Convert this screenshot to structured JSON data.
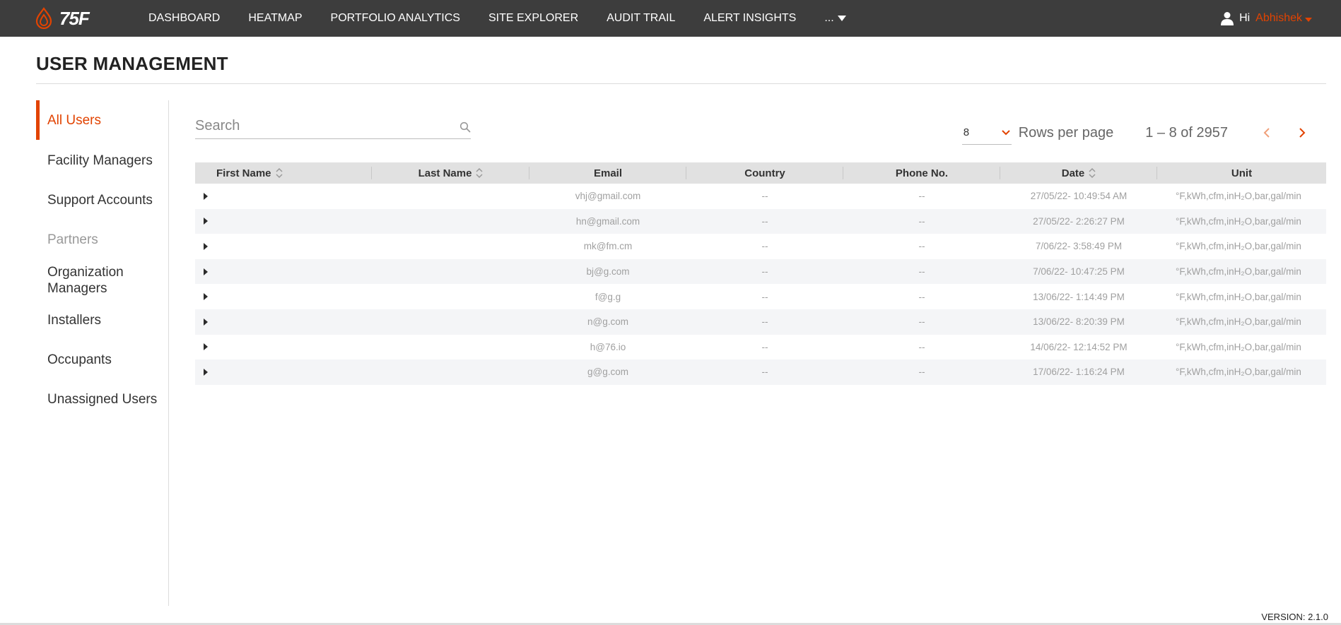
{
  "header": {
    "logo_text": "75F",
    "nav": [
      "DASHBOARD",
      "HEATMAP",
      "PORTFOLIO ANALYTICS",
      "SITE EXPLORER",
      "AUDIT TRAIL",
      "ALERT INSIGHTS"
    ],
    "more_label": "...",
    "greeting": "Hi",
    "user_name": "Abhishek"
  },
  "page": {
    "title": "USER MANAGEMENT",
    "version": "VERSION: 2.1.0"
  },
  "sidebar": {
    "items": [
      {
        "label": "All Users",
        "state": "active"
      },
      {
        "label": "Facility Managers",
        "state": "normal"
      },
      {
        "label": "Support Accounts",
        "state": "normal"
      },
      {
        "label": "Partners",
        "state": "disabled"
      },
      {
        "label": "Organization Managers",
        "state": "normal"
      },
      {
        "label": "Installers",
        "state": "normal"
      },
      {
        "label": "Occupants",
        "state": "normal"
      },
      {
        "label": "Unassigned Users",
        "state": "normal"
      }
    ]
  },
  "search": {
    "placeholder": "Search",
    "value": ""
  },
  "pagination": {
    "rows_per_page_value": "8",
    "rows_per_page_label": "Rows per page",
    "range_label": "1 – 8 of 2957"
  },
  "table": {
    "columns": [
      "First Name",
      "Last Name",
      "Email",
      "Country",
      "Phone No.",
      "Date",
      "Unit"
    ],
    "rows": [
      {
        "first_name": "",
        "last_name": "",
        "email": "vhj@gmail.com",
        "country": "--",
        "phone": "--",
        "date": "27/05/22- 10:49:54 AM",
        "unit": "°F,kWh,cfm,inH₂O,bar,gal/min"
      },
      {
        "first_name": "",
        "last_name": "",
        "email": "hn@gmail.com",
        "country": "--",
        "phone": "--",
        "date": "27/05/22- 2:26:27 PM",
        "unit": "°F,kWh,cfm,inH₂O,bar,gal/min"
      },
      {
        "first_name": "",
        "last_name": "",
        "email": "mk@fm.cm",
        "country": "--",
        "phone": "--",
        "date": "7/06/22- 3:58:49 PM",
        "unit": "°F,kWh,cfm,inH₂O,bar,gal/min"
      },
      {
        "first_name": "",
        "last_name": "",
        "email": "bj@g.com",
        "country": "--",
        "phone": "--",
        "date": "7/06/22- 10:47:25 PM",
        "unit": "°F,kWh,cfm,inH₂O,bar,gal/min"
      },
      {
        "first_name": "",
        "last_name": "",
        "email": "f@g.g",
        "country": "--",
        "phone": "--",
        "date": "13/06/22- 1:14:49 PM",
        "unit": "°F,kWh,cfm,inH₂O,bar,gal/min"
      },
      {
        "first_name": "",
        "last_name": "",
        "email": "n@g.com",
        "country": "--",
        "phone": "--",
        "date": "13/06/22- 8:20:39 PM",
        "unit": "°F,kWh,cfm,inH₂O,bar,gal/min"
      },
      {
        "first_name": "",
        "last_name": "",
        "email": "h@76.io",
        "country": "--",
        "phone": "--",
        "date": "14/06/22- 12:14:52 PM",
        "unit": "°F,kWh,cfm,inH₂O,bar,gal/min"
      },
      {
        "first_name": "",
        "last_name": "",
        "email": "g@g.com",
        "country": "--",
        "phone": "--",
        "date": "17/06/22- 1:16:24 PM",
        "unit": "°F,kWh,cfm,inH₂O,bar,gal/min"
      }
    ]
  },
  "colors": {
    "accent": "#e24301",
    "topbar": "#3d3d3d",
    "table_header": "#e1e1e1",
    "row_alt": "#f4f5f7"
  },
  "icons": [
    "logo-drop-icon",
    "user-icon",
    "caret-down-icon",
    "search-icon",
    "chevron-down-icon",
    "chevron-left-icon",
    "chevron-right-icon",
    "sort-icon",
    "expand-row-icon"
  ]
}
